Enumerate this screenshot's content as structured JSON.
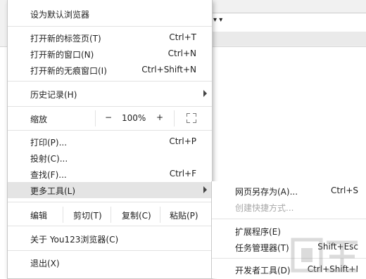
{
  "menu": {
    "set_default": "设为默认浏览器",
    "new_tab": {
      "label": "打开新的标签页(T)",
      "shortcut": "Ctrl+T"
    },
    "new_window": {
      "label": "打开新的窗口(N)",
      "shortcut": "Ctrl+N"
    },
    "new_incognito": {
      "label": "打开新的无痕窗口(I)",
      "shortcut": "Ctrl+Shift+N"
    },
    "history": {
      "label": "历史记录(H)"
    },
    "zoom": {
      "label": "缩放",
      "minus": "−",
      "value": "100%",
      "plus": "+"
    },
    "print": {
      "label": "打印(P)...",
      "shortcut": "Ctrl+P"
    },
    "cast": {
      "label": "投射(C)..."
    },
    "find": {
      "label": "查找(F)...",
      "shortcut": "Ctrl+F"
    },
    "more_tools": {
      "label": "更多工具(L)"
    },
    "edit": {
      "label": "编辑",
      "cut": "剪切(T)",
      "copy": "复制(C)",
      "paste": "粘贴(P)"
    },
    "about": {
      "label": "关于 You123浏览器(C)"
    },
    "exit": {
      "label": "退出(X)"
    }
  },
  "submenu": {
    "save_as": {
      "label": "网页另存为(A)...",
      "shortcut": "Ctrl+S"
    },
    "create_shortcut": {
      "label": "创建快捷方式..."
    },
    "extensions": {
      "label": "扩展程序(E)"
    },
    "task_manager": {
      "label": "任务管理器(T)",
      "shortcut": "Shift+Esc"
    },
    "devtools": {
      "label": "开发者工具(D)",
      "shortcut": "Ctrl+Shift+I"
    }
  },
  "toolbar": {
    "arrows": "▾ ▾"
  },
  "icons": {
    "submenu_arrow": "triangle-right-icon",
    "fullscreen": "fullscreen-icon"
  },
  "colors": {
    "highlight": "#e4e4e4",
    "disabled_text": "#a8a8a8"
  }
}
